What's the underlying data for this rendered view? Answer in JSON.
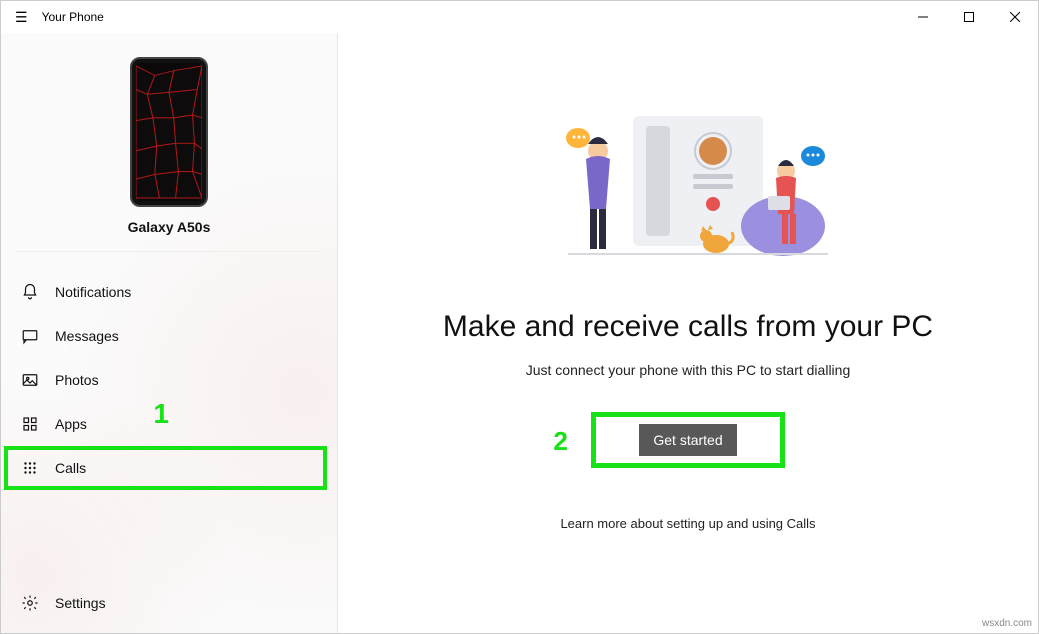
{
  "titlebar": {
    "app_title": "Your Phone"
  },
  "device": {
    "name": "Galaxy A50s"
  },
  "nav": {
    "notifications": "Notifications",
    "messages": "Messages",
    "photos": "Photos",
    "apps": "Apps",
    "calls": "Calls",
    "settings": "Settings"
  },
  "annotations": {
    "one": "1",
    "two": "2"
  },
  "main": {
    "headline": "Make and receive calls from your PC",
    "subtext": "Just connect your phone with this PC to start dialling",
    "cta": "Get started",
    "learn_more": "Learn more about setting up and using Calls"
  },
  "watermark": "wsxdn.com"
}
